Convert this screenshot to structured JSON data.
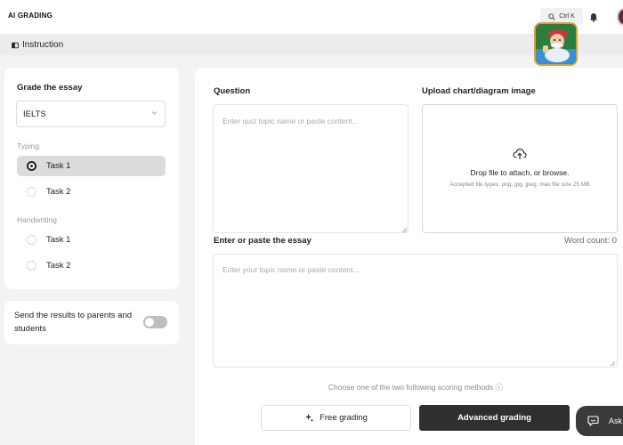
{
  "app": {
    "brand": "AI GRADING"
  },
  "topbar": {
    "search_shortcut": "Ctrl K",
    "icons": [
      "search-icon",
      "bell-icon",
      "avatar"
    ]
  },
  "subbar": {
    "instruction_label": "Instruction"
  },
  "sidebar": {
    "title": "Grade the essay",
    "exam_select": {
      "value": "IELTS"
    },
    "groups": [
      {
        "label": "Typing",
        "options": [
          {
            "label": "Task 1",
            "selected": true
          },
          {
            "label": "Task 2",
            "selected": false
          }
        ]
      },
      {
        "label": "Handwriting",
        "options": [
          {
            "label": "Task 1",
            "selected": false
          },
          {
            "label": "Task 2",
            "selected": false
          }
        ]
      }
    ],
    "send_results": {
      "label": "Send the results to parents and students",
      "enabled": false
    }
  },
  "main": {
    "question": {
      "label": "Question",
      "placeholder": "Enter quiz topic name or paste content..."
    },
    "upload": {
      "label": "Upload chart/diagram image",
      "drop_text": "Drop file to attach, or browse.",
      "accepted_text": "Accepted file types: png, jpg, jpeg, max file size 25 MB"
    },
    "essay": {
      "label": "Enter or paste the essay",
      "placeholder": "Enter your topic name or paste content...",
      "word_count": "Word count: 0"
    },
    "methods_text": "Choose one of the two following scoring methods ⓘ",
    "free_button": "Free grading",
    "advanced_button": "Advanced grading"
  },
  "ask_button": {
    "label": "Ask"
  },
  "colors": {
    "accent_dark": "#2f2f2f",
    "page_bg": "#f3f3f3",
    "selected_bg": "#dcdcdc"
  }
}
